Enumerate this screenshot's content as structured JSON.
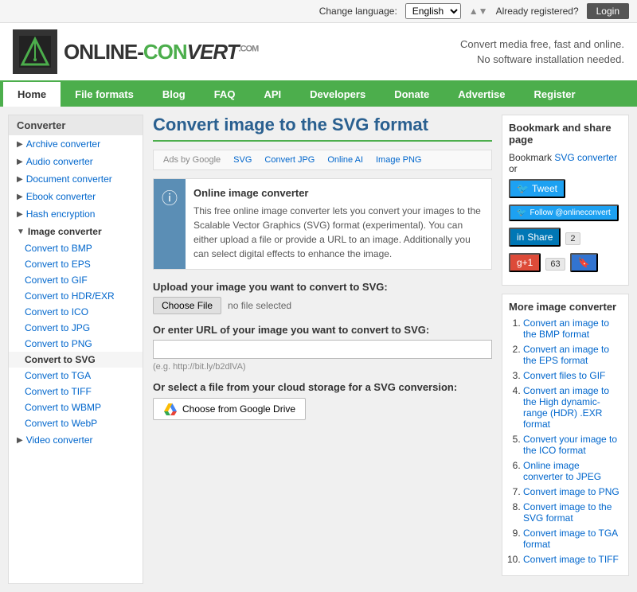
{
  "topbar": {
    "change_language": "Change language:",
    "language": "English",
    "already_registered": "Already registered?",
    "login_label": "Login"
  },
  "header": {
    "logo_text_part1": "ONLINE-",
    "logo_text_part2": "CONVERT",
    "logo_com": ".COM",
    "tagline_line1": "Convert media free, fast and online.",
    "tagline_line2": "No software installation needed."
  },
  "nav": {
    "items": [
      {
        "label": "Home",
        "active": true
      },
      {
        "label": "File formats"
      },
      {
        "label": "Blog"
      },
      {
        "label": "FAQ"
      },
      {
        "label": "API"
      },
      {
        "label": "Developers"
      },
      {
        "label": "Donate"
      },
      {
        "label": "Advertise"
      },
      {
        "label": "Register"
      }
    ]
  },
  "sidebar": {
    "title": "Converter",
    "items": [
      {
        "label": "Archive converter",
        "arrow": "▶"
      },
      {
        "label": "Audio converter",
        "arrow": "▶"
      },
      {
        "label": "Document converter",
        "arrow": "▶"
      },
      {
        "label": "Ebook converter",
        "arrow": "▶"
      },
      {
        "label": "Hash encryption",
        "arrow": "▶"
      },
      {
        "label": "Image converter",
        "arrow": "▼",
        "active": true
      }
    ],
    "sub_items": [
      {
        "label": "Convert to BMP"
      },
      {
        "label": "Convert to EPS"
      },
      {
        "label": "Convert to GIF"
      },
      {
        "label": "Convert to HDR/EXR"
      },
      {
        "label": "Convert to ICO"
      },
      {
        "label": "Convert to JPG"
      },
      {
        "label": "Convert to PNG"
      },
      {
        "label": "Convert to SVG",
        "active": true
      },
      {
        "label": "Convert to TGA"
      },
      {
        "label": "Convert to TIFF"
      },
      {
        "label": "Convert to WBMP"
      },
      {
        "label": "Convert to WebP"
      }
    ],
    "video_item": {
      "label": "Video converter",
      "arrow": "▶"
    }
  },
  "content": {
    "page_title": "Convert image to the SVG format",
    "ad_label": "Ads by Google",
    "ad_links": [
      "SVG",
      "Convert JPG",
      "Online AI",
      "Image PNG"
    ],
    "desc_title": "Online image converter",
    "desc_body": "This free online image converter lets you convert your images to the Scalable Vector Graphics (SVG) format (experimental). You can either upload a file or provide a URL to an image. Additionally you can select digital effects to enhance the image.",
    "upload_title": "Upload your image you want to convert to SVG:",
    "choose_file_label": "Choose File",
    "no_file_text": "no file selected",
    "url_title": "Or enter URL of your image you want to convert to SVG:",
    "url_placeholder": "",
    "url_hint": "(e.g. http://bit.ly/b2dlVA)",
    "cloud_title": "Or select a file from your cloud storage for a SVG conversion:",
    "google_drive_label": "Choose from Google Drive"
  },
  "right_sidebar": {
    "bookmark_title": "Bookmark and share page",
    "bookmark_text": "Bookmark",
    "svg_link": "SVG converter",
    "bookmark_or": "or",
    "tweet_label": "Tweet",
    "follow_label": "Follow @onlineconvert",
    "share_label": "Share",
    "share_count": "2",
    "gplus_count": "63",
    "more_title": "More image converter",
    "more_items": [
      "Convert an image to the BMP format",
      "Convert an image to the EPS format",
      "Convert files to GIF",
      "Convert an image to the High dynamic-range (HDR) .EXR format",
      "Convert your image to the ICO format",
      "Online image converter to JPEG",
      "Convert image to PNG",
      "Convert image to the SVG format",
      "Convert image to TGA format",
      "Convert image to TIFF"
    ]
  }
}
